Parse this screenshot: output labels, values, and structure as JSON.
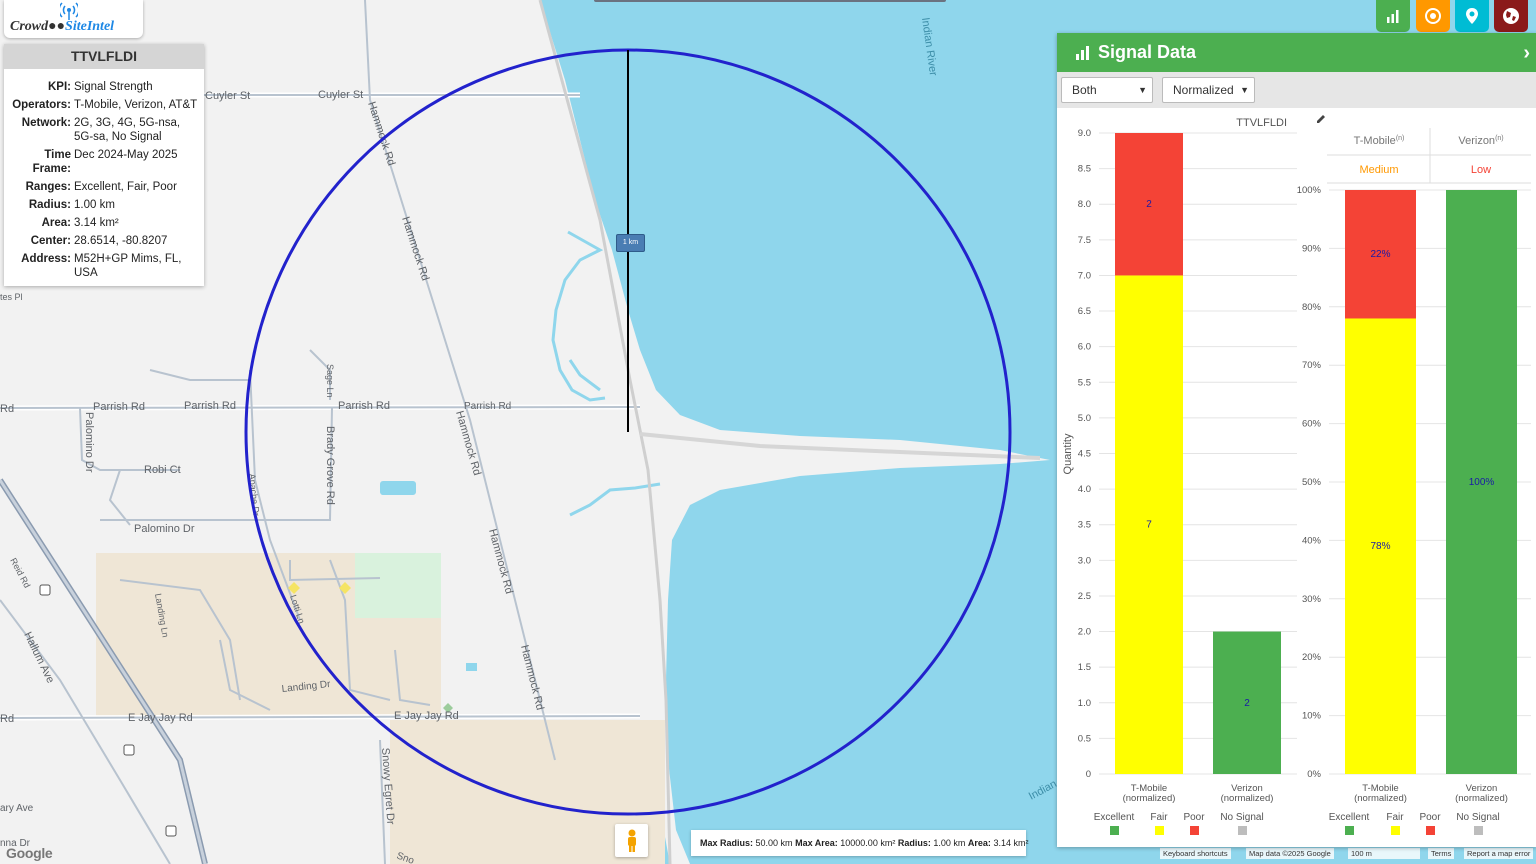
{
  "map": {
    "streets": {
      "cuyler_st_1": "Cuyler St",
      "cuyler_st_2": "Cuyler St",
      "hammock_rd_1": "Hammock Rd",
      "hammock_rd_2": "Hammock Rd",
      "hammock_rd_3": "Hammock Rd",
      "hammock_rd_4": "Hammock Rd",
      "hammock_rd_5": "Hammock Rd",
      "parrish_rd_1": "Rd",
      "parrish_rd_2": "Parrish Rd",
      "parrish_rd_3": "Parrish Rd",
      "parrish_rd_4": "Parrish Rd",
      "parrish_rd_5": "Parrish Rd",
      "palomino_dr_1": "Palomino Dr",
      "palomino_dr_2": "Palomino Dr",
      "robi_ct": "Robi Ct",
      "sage_ln": "Sage Ln",
      "brady_grove_rd": "Brady Grove Rd",
      "apache_dr": "Apache Dr",
      "reid_rd": "Reid Rd",
      "hallum_ave": "Hallum Ave",
      "landing_ln": "Landing Ln",
      "landing_dr": "Landing Dr",
      "lotti_ln": "Lotti Ln",
      "e_jay_jay_rd_1": "E Jay Jay Rd",
      "e_jay_jay_rd_2": "E Jay Jay Rd",
      "e_jay_jay_rd_3": "Rd",
      "snowy_egret_dr": "Snowy Egret Dr",
      "snowy_short": "Sno",
      "ary_ave": "ary Ave",
      "nna_dr": "nna Dr",
      "tes_pl": "tes Pl"
    },
    "water": {
      "indian_river": "Indian River",
      "indian_short": "Indian"
    },
    "distance_label": "1 km"
  },
  "logo": {
    "crowd": "Crowd",
    "site": "SiteIntel"
  },
  "info": {
    "title": "TTVLFLDI",
    "rows": [
      {
        "key": "KPI:",
        "value": "Signal Strength"
      },
      {
        "key": "Operators:",
        "value": "T-Mobile, Verizon, AT&T"
      },
      {
        "key": "Network:",
        "value": "2G, 3G, 4G, 5G-nsa, 5G-sa, No Signal"
      },
      {
        "key": "Time Frame:",
        "value": "Dec 2024-May 2025"
      },
      {
        "key": "Ranges:",
        "value": "Excellent, Fair, Poor"
      },
      {
        "key": "Radius:",
        "value": "1.00 km"
      },
      {
        "key": "Area:",
        "value": "3.14 km²"
      },
      {
        "key": "Center:",
        "value": "28.6514, -80.8207"
      },
      {
        "key": "Address:",
        "value": "M52H+GP Mims, FL, USA"
      }
    ]
  },
  "radius_box": {
    "max_radius_label": "Max Radius:",
    "max_radius": "50.00 km",
    "max_area_label": "Max Area:",
    "max_area": "10000.00 km²",
    "radius_label": "Radius:",
    "radius": "1.00 km",
    "area_label": "Area:",
    "area": "3.14 km²"
  },
  "footer": {
    "google": "Google",
    "shortcuts": "Keyboard shortcuts",
    "map_data": "Map data ©2025 Google",
    "scale": "100 m",
    "terms": "Terms",
    "report": "Report a map error"
  },
  "colors": {
    "excellent": "#4caf50",
    "fair": "#ffff00",
    "poor": "#f44336",
    "no_signal": "#bdbdbd",
    "circle": "#2222cc",
    "water": "#8fd6ec",
    "header_green": "#4caf50",
    "btn_green": "#4caf50",
    "btn_orange": "#ff9800",
    "btn_cyan": "#00bcd4",
    "btn_darkred": "#8b1a1a"
  },
  "top_buttons": [
    {
      "name": "chart-icon"
    },
    {
      "name": "target-icon"
    },
    {
      "name": "pin-icon"
    },
    {
      "name": "globe-icon"
    }
  ],
  "panel": {
    "title": "Signal Data",
    "select_operator": "Both",
    "select_mode": "Normalized",
    "chart_title": "TTVLFLDI"
  },
  "chart_data": [
    {
      "type": "bar",
      "stacked": true,
      "title": "TTVLFLDI",
      "ylabel": "Quantity",
      "ylim": [
        0,
        9
      ],
      "yticks": [
        "0",
        "0.5",
        "1.0",
        "1.5",
        "2.0",
        "2.5",
        "3.0",
        "3.5",
        "4.0",
        "4.5",
        "5.0",
        "5.5",
        "6.0",
        "6.5",
        "7.0",
        "7.5",
        "8.0",
        "8.5",
        "9.0"
      ],
      "categories": [
        "T-Mobile\n(normalized)",
        "Verizon\n(normalized)"
      ],
      "category_lines": [
        [
          "T-Mobile",
          "(normalized)"
        ],
        [
          "Verizon",
          "(normalized)"
        ]
      ],
      "series": [
        {
          "name": "Excellent",
          "values": [
            0,
            2
          ],
          "labels": [
            "",
            "2"
          ]
        },
        {
          "name": "Fair",
          "values": [
            7,
            0
          ],
          "labels": [
            "7",
            ""
          ]
        },
        {
          "name": "Poor",
          "values": [
            2,
            0
          ],
          "labels": [
            "2",
            ""
          ]
        },
        {
          "name": "No Signal",
          "values": [
            0,
            0
          ],
          "labels": [
            "",
            ""
          ]
        }
      ],
      "legend": [
        "Excellent",
        "Fair",
        "Poor",
        "No Signal"
      ]
    },
    {
      "type": "bar",
      "stacked": true,
      "ylim": [
        0,
        100
      ],
      "yticks": [
        "0%",
        "10%",
        "20%",
        "30%",
        "40%",
        "50%",
        "60%",
        "70%",
        "80%",
        "90%",
        "100%"
      ],
      "categories": [
        "T-Mobile\n(normalized)",
        "Verizon\n(normalized)"
      ],
      "category_lines": [
        [
          "T-Mobile",
          "(normalized)"
        ],
        [
          "Verizon",
          "(normalized)"
        ]
      ],
      "header": [
        {
          "name": "T-Mobile",
          "sup": "(n)",
          "rating": "Medium",
          "rating_color": "#ff9800"
        },
        {
          "name": "Verizon",
          "sup": "(n)",
          "rating": "Low",
          "rating_color": "#f44336"
        }
      ],
      "series": [
        {
          "name": "Excellent",
          "values": [
            0,
            100
          ],
          "labels": [
            "",
            "100%"
          ]
        },
        {
          "name": "Fair",
          "values": [
            78,
            0
          ],
          "labels": [
            "78%",
            ""
          ]
        },
        {
          "name": "Poor",
          "values": [
            22,
            0
          ],
          "labels": [
            "22%",
            ""
          ]
        },
        {
          "name": "No Signal",
          "values": [
            0,
            0
          ],
          "labels": [
            "",
            ""
          ]
        }
      ],
      "legend": [
        "Excellent",
        "Fair",
        "Poor",
        "No Signal"
      ]
    }
  ]
}
